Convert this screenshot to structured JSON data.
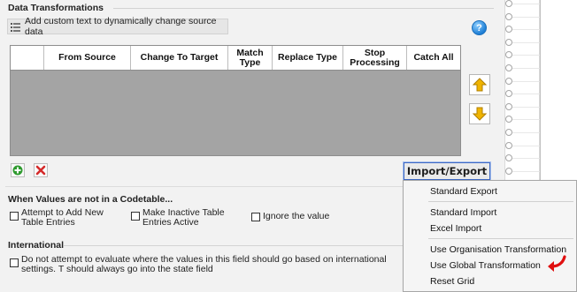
{
  "data_transformations": {
    "title": "Data Transformations",
    "dynamic_button_label": "Add custom text to dynamically change source data",
    "help_glyph": "?",
    "grid": {
      "columns": [
        "",
        "From Source",
        "Change To Target",
        "Match Type",
        "Replace Type",
        "Stop Processing",
        "Catch All"
      ],
      "rows": []
    },
    "import_export_label": "Import/Export"
  },
  "codetable": {
    "title": "When Values are not in a Codetable...",
    "options": {
      "add_new": "Attempt to Add New Table Entries",
      "make_inactive": "Make Inactive Table Entries Active",
      "ignore": "Ignore the value"
    }
  },
  "international": {
    "title": "International",
    "option": "Do not attempt to evaluate where the values in this field should go based on international settings. T should always go into the state field"
  },
  "menu": {
    "standard_export": "Standard Export",
    "standard_import": "Standard Import",
    "excel_import": "Excel Import",
    "use_org_transformation": "Use Organisation Transformation",
    "use_global_transformation": "Use Global Transformation",
    "reset_grid": "Reset Grid"
  },
  "colors": {
    "accent_border": "#3c68c4",
    "grid_body": "#a4a4a4",
    "annotation_arrow": "#e01010",
    "add_green": "#2f9a2f",
    "delete_red": "#d42a2a",
    "arrow_yellow": "#f0b400"
  },
  "icons": {
    "dynamic_button": "list-icon",
    "help": "help-icon",
    "move_up": "arrow-up-icon",
    "move_down": "arrow-down-icon",
    "add_row": "add-icon",
    "delete_row": "delete-icon",
    "annotation": "annotation-arrow-icon"
  }
}
